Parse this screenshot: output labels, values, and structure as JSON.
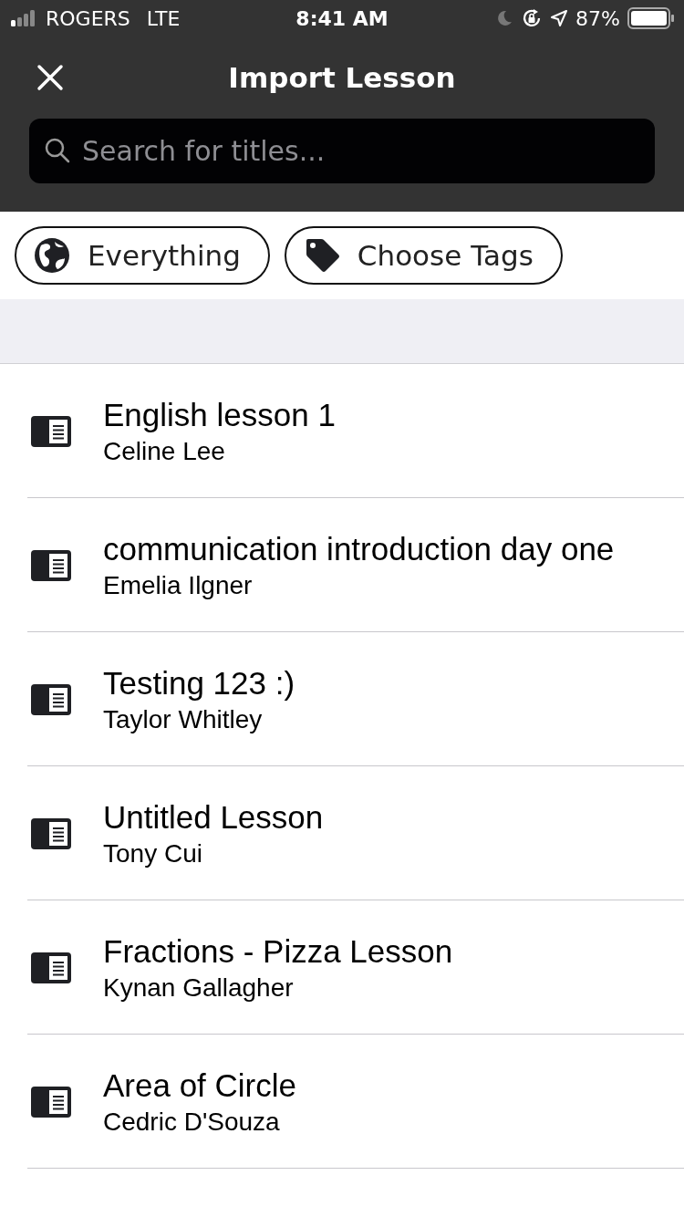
{
  "status_bar": {
    "carrier": "ROGERS",
    "network": "LTE",
    "time": "8:41 AM",
    "battery": "87%"
  },
  "header": {
    "title": "Import Lesson"
  },
  "search": {
    "placeholder": "Search for titles..."
  },
  "filters": [
    {
      "kind": "globe",
      "label": "Everything"
    },
    {
      "kind": "tag",
      "label": "Choose Tags"
    }
  ],
  "lessons": [
    {
      "title": "English lesson 1",
      "author": "Celine Lee"
    },
    {
      "title": "communication introduction day one",
      "author": "Emelia Ilgner"
    },
    {
      "title": "Testing 123 :)",
      "author": "Taylor Whitley"
    },
    {
      "title": "Untitled Lesson",
      "author": "Tony Cui"
    },
    {
      "title": "Fractions - Pizza Lesson",
      "author": "Kynan Gallagher"
    },
    {
      "title": "Area of Circle",
      "author": "Cedric D'Souza"
    }
  ]
}
